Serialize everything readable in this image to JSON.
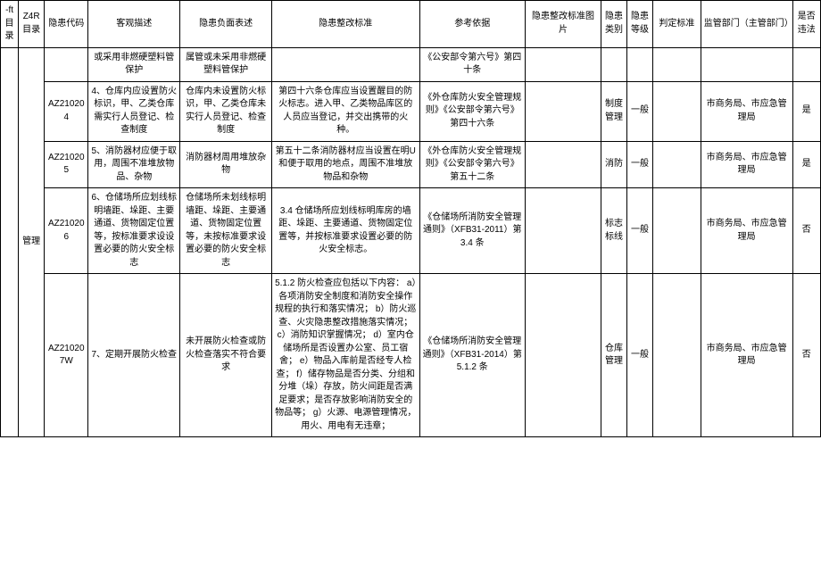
{
  "header": {
    "c_seq": "-ft 目录",
    "c_z4r": "Z4R目录",
    "c_code": "隐患代码",
    "c_obj": "客观描述",
    "c_neg": "隐患负面表述",
    "c_std": "隐患整改标准",
    "c_ref": "参考依据",
    "c_img": "隐患整改标准图片",
    "c_cat": "隐患类别",
    "c_lvl": "隐患等级",
    "c_judge": "判定标准",
    "c_dept": "监管部门（主管部门）",
    "c_law": "是否违法"
  },
  "col_mgmt": "管理",
  "rows": [
    {
      "code": "",
      "obj": "或采用非燃硬塑料管保护",
      "neg": "属管或未采用非燃硬塑料管保护",
      "std": "",
      "ref": "《公安部令第六号》第四十条",
      "img": "",
      "cat": "",
      "lvl": "",
      "judge": "",
      "dept": "",
      "law": ""
    },
    {
      "code": "AZ210204",
      "obj": "4、仓库内应设置防火标识，甲、乙类仓库需实行人员登记、检查制度",
      "neg": "仓库内未设置防火标识，甲、乙类仓库未实行人员登记、检查制度",
      "std": "第四十六条仓库应当设置醒目的防火标志。进入甲、乙类物品库区的人员应当登记，并交出携带的火种。",
      "ref": "《外仓库防火安全管理规则》《公安部令第六号》第四十六条",
      "img": "",
      "cat": "制度管理",
      "lvl": "一般",
      "judge": "",
      "dept": "市商务局、市应急管理局",
      "law": "是"
    },
    {
      "code": "AZ210205",
      "obj": "5、消防器材应便于取用，周围不准堆放物品、杂物",
      "neg": "消防器材周用堆放杂物",
      "std": "第五十二条消防器材应当设置在明U和便于取用的地点，周围不准堆放物品和杂物",
      "ref": "《外仓库防火安全管理规则》《公安部令第六号》第五十二条",
      "img": "",
      "cat": "消防",
      "lvl": "一般",
      "judge": "",
      "dept": "市商务局、市应急管理局",
      "law": "是"
    },
    {
      "code": "AZ210206",
      "obj": "6、仓储场所应划线标明墙距、垛距、主要通道、货物固定位置等，按标准要求设设置必要的防火安全标志",
      "neg": "仓储场所未划线标明墙距、垛距、主要通道、货物固定位置等，未按标准要求设置必要的防火安全标志",
      "std": "3.4 仓储场所应划线标明库房的墙距、垛距、主要通道、货物固定位置等，并按标准要求设置必要的防火安全标志。",
      "ref": "《仓储场所消防安全管理通则》（XFB31-2011）第 3.4 条",
      "img": "",
      "cat": "标志标线",
      "lvl": "一般",
      "judge": "",
      "dept": "市商务局、市应急管理局",
      "law": "否"
    },
    {
      "code": "AZ210207W",
      "obj": "7、定期开展防火检查",
      "neg": "未开展防火检查或防火检查落实不符合要求",
      "std": "5.1.2 防火检查应包括以下内容：\na）各项消防安全制度和消防安全操作规程的执行和落实情况；\nb）防火巡查、火灾隐患整改措施落实情况；\nc）消防知识掌握情况；\nd）室内仓储场所是否设置办公室、员工宿舍；\ne）物品入库前是否经专人检查；\nf）储存物品是否分类、分组和分堆（垛）存放，防火间距是否满足要求；是否存放影响消防安全的物品等；\ng）火源、电源管理情况，用火、用电有无违章；",
      "ref": "《仓储场所消防安全管理通则》（XFB31-2014）第 5.1.2 条",
      "img": "",
      "cat": "仓库管理",
      "lvl": "一般",
      "judge": "",
      "dept": "市商务局、市应急管理局",
      "law": "否"
    }
  ]
}
